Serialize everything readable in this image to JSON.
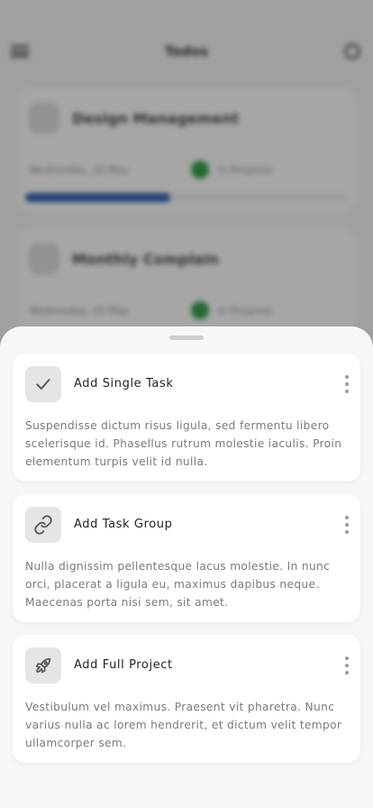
{
  "background": {
    "title": "Todos",
    "cards": [
      {
        "name": "Design Management",
        "date": "Wednesday, 20 May",
        "status": "In Progress",
        "progress": 0.45
      },
      {
        "name": "Monthly Complain",
        "date": "Wednesday, 20 May",
        "status": "In Progress"
      }
    ]
  },
  "sheet": {
    "options": [
      {
        "icon": "check-icon",
        "title": "Add Single Task",
        "description": "Suspendisse dictum risus ligula, sed fermentu libero scelerisque id. Phasellus rutrum molestie iaculis. Proin elementum turpis velit id nulla."
      },
      {
        "icon": "link-icon",
        "title": "Add Task Group",
        "description": "Nulla dignissim pellentesque lacus molestie. In nunc orci, placerat a ligula eu, maximus dapibus neque. Maecenas porta nisi sem, sit amet."
      },
      {
        "icon": "rocket-icon",
        "title": "Add Full Project",
        "description": "Vestibulum vel maximus. Praesent vit pharetra. Nunc varius nulla ac lorem hendrerit, et dictum velit tempor ullamcorper sem."
      }
    ]
  }
}
